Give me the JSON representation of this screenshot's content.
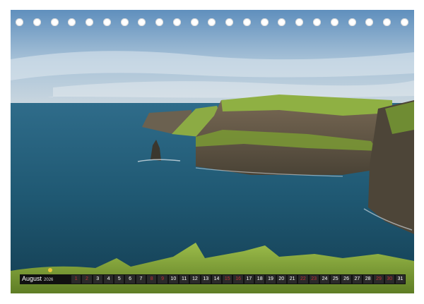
{
  "calendar": {
    "month": "August",
    "year": "2026",
    "days": [
      {
        "n": "1",
        "weekend": true
      },
      {
        "n": "2",
        "weekend": true
      },
      {
        "n": "3",
        "weekend": false
      },
      {
        "n": "4",
        "weekend": false
      },
      {
        "n": "5",
        "weekend": false
      },
      {
        "n": "6",
        "weekend": false
      },
      {
        "n": "7",
        "weekend": false
      },
      {
        "n": "8",
        "weekend": true
      },
      {
        "n": "9",
        "weekend": true
      },
      {
        "n": "10",
        "weekend": false
      },
      {
        "n": "11",
        "weekend": false
      },
      {
        "n": "12",
        "weekend": false
      },
      {
        "n": "13",
        "weekend": false
      },
      {
        "n": "14",
        "weekend": false
      },
      {
        "n": "15",
        "weekend": true
      },
      {
        "n": "16",
        "weekend": true
      },
      {
        "n": "17",
        "weekend": false
      },
      {
        "n": "18",
        "weekend": false
      },
      {
        "n": "19",
        "weekend": false
      },
      {
        "n": "20",
        "weekend": false
      },
      {
        "n": "21",
        "weekend": false
      },
      {
        "n": "22",
        "weekend": true
      },
      {
        "n": "23",
        "weekend": true
      },
      {
        "n": "24",
        "weekend": false
      },
      {
        "n": "25",
        "weekend": false
      },
      {
        "n": "26",
        "weekend": false
      },
      {
        "n": "27",
        "weekend": false
      },
      {
        "n": "28",
        "weekend": false
      },
      {
        "n": "29",
        "weekend": true
      },
      {
        "n": "30",
        "weekend": true
      },
      {
        "n": "31",
        "weekend": false
      }
    ]
  },
  "binding": {
    "hole_count": 23
  },
  "colors": {
    "weekend_text": "#c0303a",
    "strip_background": "#111111",
    "sea": "#1d4f66",
    "sky": "#8fb3cf",
    "grass": "#7fa03a"
  }
}
